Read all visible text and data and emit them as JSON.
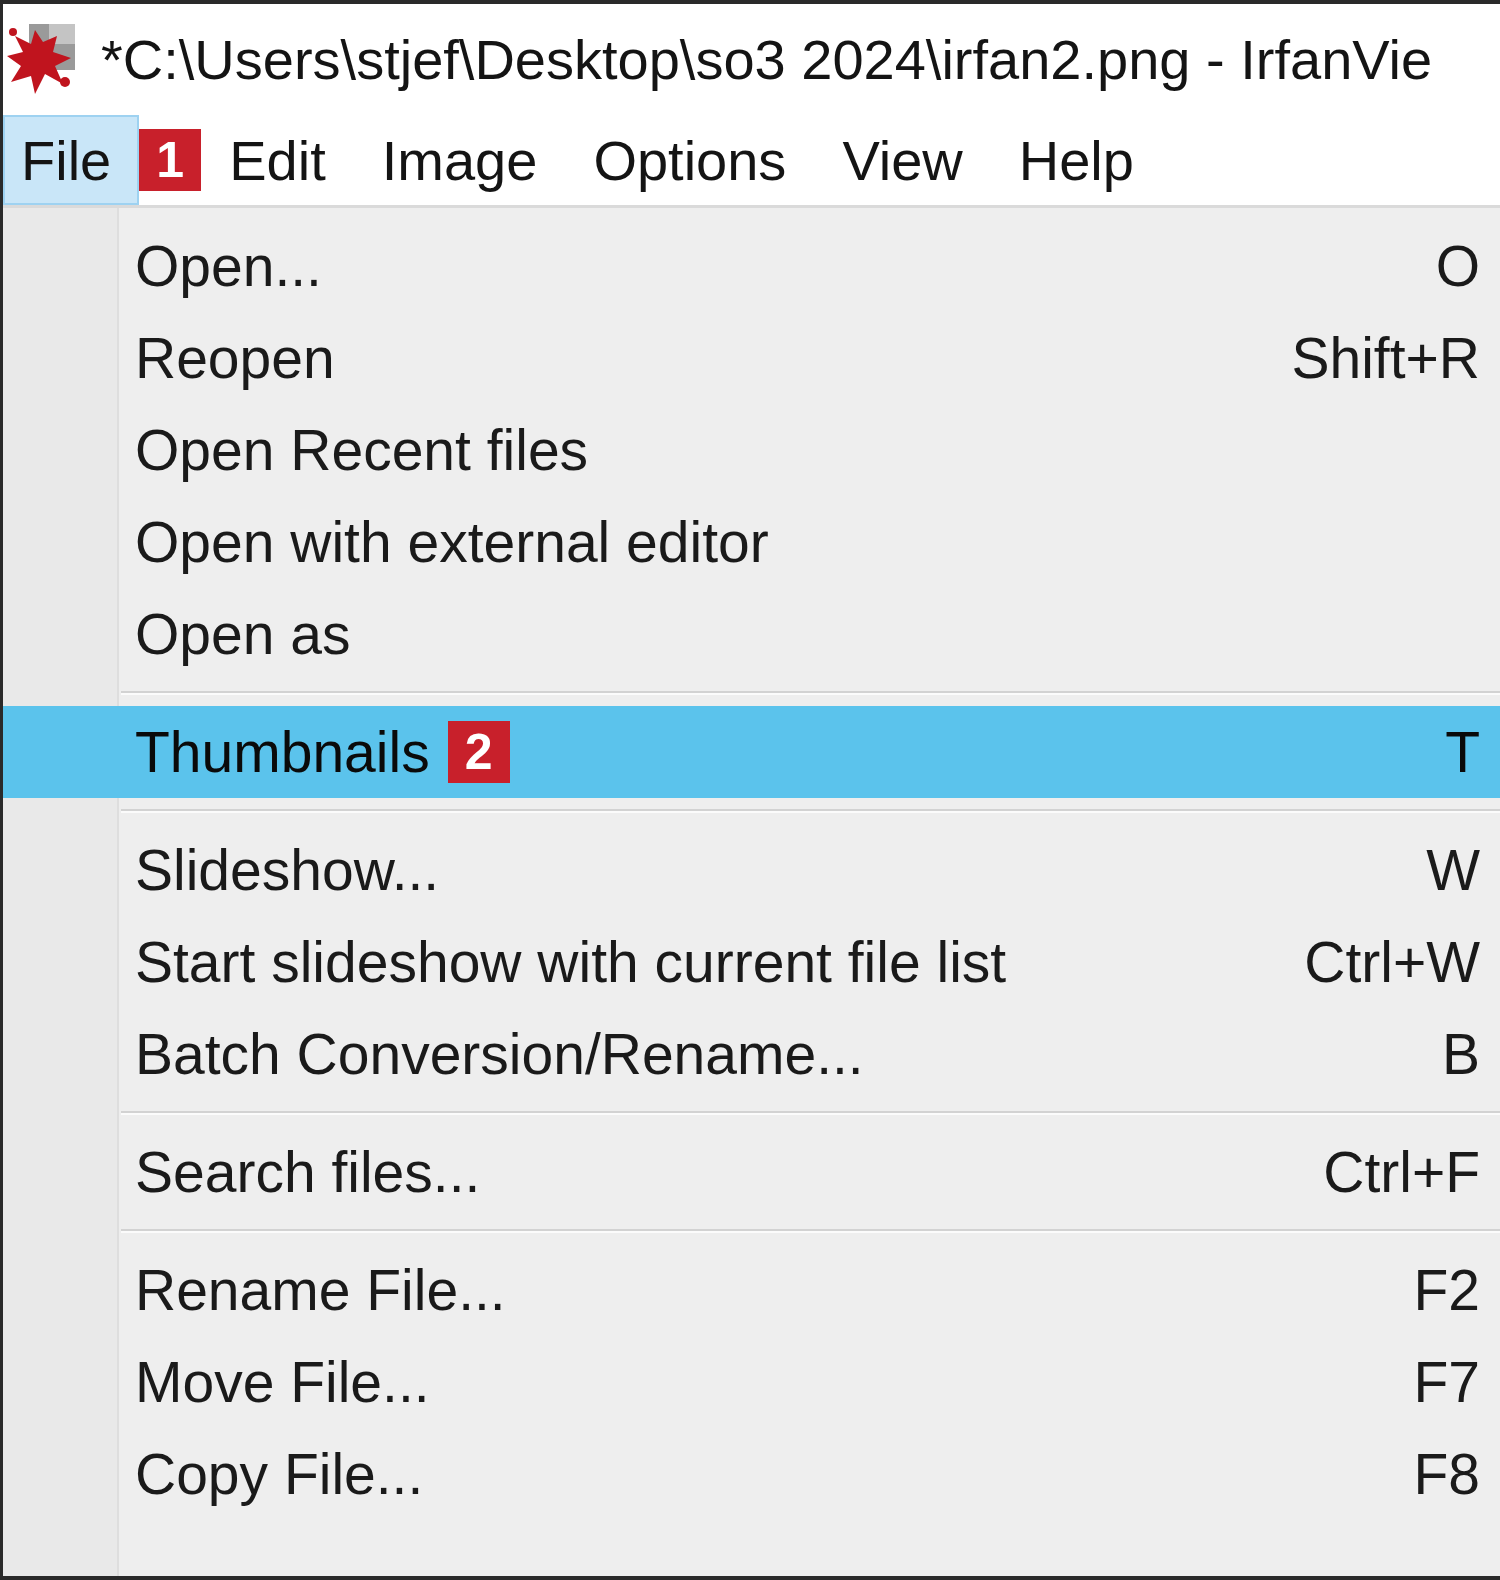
{
  "window": {
    "title": "*C:\\Users\\stjef\\Desktop\\so3 2024\\irfan2.png - IrfanVie"
  },
  "menu_bar": {
    "items": [
      {
        "label": "File",
        "selected": true,
        "badge": "1"
      },
      {
        "label": "Edit",
        "selected": false
      },
      {
        "label": "Image",
        "selected": false
      },
      {
        "label": "Options",
        "selected": false
      },
      {
        "label": "View",
        "selected": false
      },
      {
        "label": "Help",
        "selected": false
      }
    ]
  },
  "dropdown": {
    "groups": [
      [
        {
          "label": "Open...",
          "shortcut": "O",
          "selected": false
        },
        {
          "label": "Reopen",
          "shortcut": "Shift+R",
          "selected": false
        },
        {
          "label": "Open Recent files",
          "selected": false
        },
        {
          "label": "Open with external editor",
          "selected": false
        },
        {
          "label": "Open as",
          "selected": false
        }
      ],
      [
        {
          "label": "Thumbnails",
          "shortcut": "T",
          "selected": true,
          "badge": "2"
        }
      ],
      [
        {
          "label": "Slideshow...",
          "shortcut": "W",
          "selected": false
        },
        {
          "label": "Start slideshow with current file list",
          "shortcut": "Ctrl+W",
          "selected": false
        },
        {
          "label": "Batch Conversion/Rename...",
          "shortcut": "B",
          "selected": false
        }
      ],
      [
        {
          "label": "Search files...",
          "shortcut": "Ctrl+F",
          "selected": false
        }
      ],
      [
        {
          "label": "Rename File...",
          "shortcut": "F2",
          "selected": false
        },
        {
          "label": "Move File...",
          "shortcut": "F7",
          "selected": false
        },
        {
          "label": "Copy File...",
          "shortcut": "F8",
          "selected": false
        }
      ]
    ]
  }
}
